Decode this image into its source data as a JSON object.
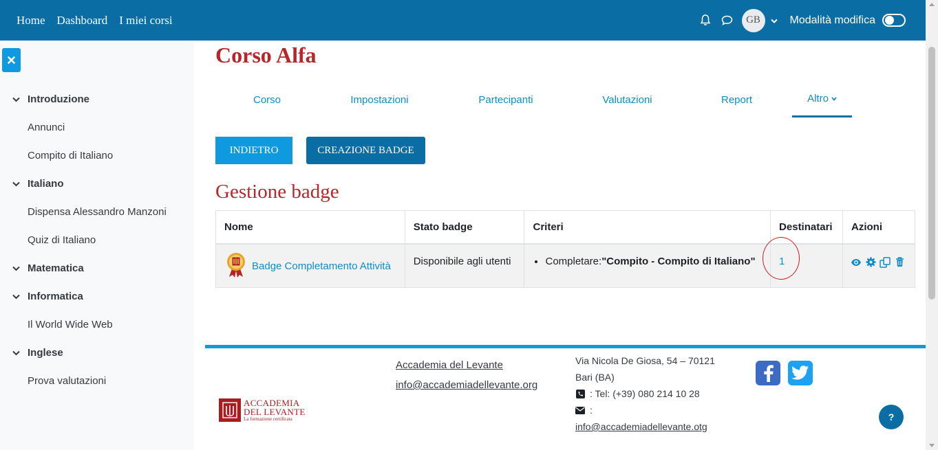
{
  "navbar": {
    "links": [
      "Home",
      "Dashboard",
      "I miei corsi"
    ],
    "avatar_initials": "GB",
    "edit_mode_label": "Modalità modifica",
    "bg_color": "#0a6ea4"
  },
  "sidebar": {
    "close_icon": "close-icon",
    "items": [
      {
        "type": "section",
        "label": "Introduzione"
      },
      {
        "type": "item",
        "label": "Annunci"
      },
      {
        "type": "item",
        "label": "Compito di Italiano"
      },
      {
        "type": "section",
        "label": "Italiano"
      },
      {
        "type": "item",
        "label": "Dispensa Alessandro Manzoni"
      },
      {
        "type": "item",
        "label": "Quiz di Italiano"
      },
      {
        "type": "section",
        "label": "Matematica"
      },
      {
        "type": "section",
        "label": "Informatica"
      },
      {
        "type": "item",
        "label": "Il World Wide Web"
      },
      {
        "type": "section",
        "label": "Inglese"
      },
      {
        "type": "item",
        "label": "Prova valutazioni"
      }
    ]
  },
  "main": {
    "course_title": "Corso Alfa",
    "tabs": [
      {
        "label": "Corso"
      },
      {
        "label": "Impostazioni"
      },
      {
        "label": "Partecipanti"
      },
      {
        "label": "Valutazioni"
      },
      {
        "label": "Report"
      },
      {
        "label": "Altro",
        "active": true
      }
    ],
    "back_button": "INDIETRO",
    "create_button": "CREAZIONE BADGE",
    "section_title": "Gestione badge",
    "table": {
      "headers": [
        "Nome",
        "Stato badge",
        "Criteri",
        "Destinatari",
        "Azioni"
      ],
      "rows": [
        {
          "name": "Badge Completamento Attività",
          "status": "Disponibile agli utenti",
          "criteria_prefix": "Completare:",
          "criteria_bold": "\"Compito - Compito di Italiano\"",
          "recipients": "1",
          "actions": [
            "eye-icon",
            "gear-icon",
            "copy-icon",
            "trash-icon"
          ]
        }
      ]
    }
  },
  "footer": {
    "logo_line1": "ACCADEMIA",
    "logo_line2": "DEL LEVANTE",
    "logo_tagline": "La formazione certificata",
    "org_name": "Accademia del Levante",
    "org_email": "info@accademiadellevante.org",
    "address_line1": "Via Nicola De Giosa, 54 – 70121",
    "address_line2": "Bari (BA)",
    "phone": ": Tel: (+39) 080 214 10 28",
    "email_sep": ":",
    "contact_email": "info@accademiadellevante.otg",
    "social": [
      "facebook-icon",
      "twitter-icon"
    ],
    "help_label": "?"
  },
  "colors": {
    "accent": "#0f9ae0",
    "brand_red": "#b7262b",
    "primary": "#0a6ea4"
  }
}
